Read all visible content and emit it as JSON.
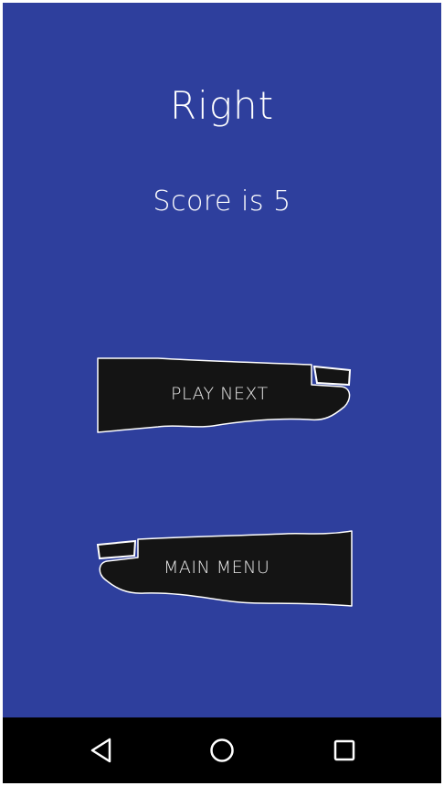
{
  "result": {
    "title": "Right",
    "score_text": "Score is 5"
  },
  "buttons": {
    "play_next": "PLAY NEXT",
    "main_menu": "MAIN MENU"
  },
  "navbar": {
    "back_icon": "back-triangle-icon",
    "home_icon": "home-circle-icon",
    "recent_icon": "recent-apps-square-icon"
  },
  "colors": {
    "background": "#2e3f9d",
    "button_fill": "#141414",
    "button_outline": "#ffffff",
    "text": "#ffffff",
    "navbar": "#000000"
  }
}
